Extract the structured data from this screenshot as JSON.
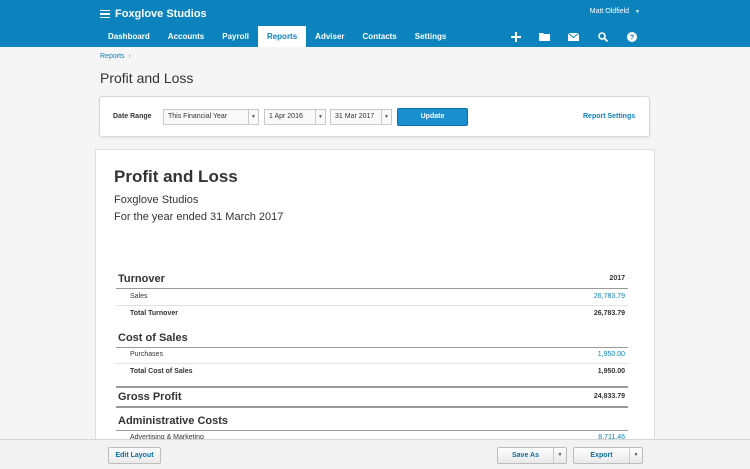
{
  "header": {
    "org_name": "Foxglove Studios",
    "user_name": "Matt Oldfield",
    "tabs": [
      {
        "label": "Dashboard"
      },
      {
        "label": "Accounts"
      },
      {
        "label": "Payroll"
      },
      {
        "label": "Reports"
      },
      {
        "label": "Adviser"
      },
      {
        "label": "Contacts"
      },
      {
        "label": "Settings"
      }
    ],
    "active_tab": "Reports",
    "icons": [
      "add-icon",
      "folder-icon",
      "mail-icon",
      "search-icon",
      "help-icon"
    ]
  },
  "breadcrumb": {
    "item": "Reports",
    "separator": "›"
  },
  "page_title": "Profit and Loss",
  "filters": {
    "date_range_label": "Date Range",
    "range_select": "This Financial Year",
    "from_date": "1 Apr 2016",
    "to_date": "31 Mar 2017",
    "update_label": "Update",
    "report_settings_label": "Report Settings"
  },
  "report": {
    "title": "Profit and Loss",
    "organisation": "Foxglove Studios",
    "period": "For the year ended 31 March 2017",
    "column_year": "2017",
    "turnover": {
      "heading": "Turnover",
      "items": [
        {
          "label": "Sales",
          "value": "26,783.79"
        }
      ],
      "total_label": "Total Turnover",
      "total_value": "26,783.79"
    },
    "cost_of_sales": {
      "heading": "Cost of Sales",
      "items": [
        {
          "label": "Purchases",
          "value": "1,950.00"
        }
      ],
      "total_label": "Total Cost of Sales",
      "total_value": "1,950.00"
    },
    "gross_profit": {
      "label": "Gross Profit",
      "value": "24,833.79"
    },
    "admin_costs": {
      "heading": "Administrative Costs",
      "items": [
        {
          "label": "Advertising & Marketing",
          "value": "8,711.46"
        }
      ]
    }
  },
  "footer": {
    "edit_layout_label": "Edit Layout",
    "save_as_label": "Save As",
    "export_label": "Export"
  },
  "colors": {
    "brand_blue": "#0d83bd",
    "link_blue": "#0d83bd",
    "update_button": "#1a8fd0"
  }
}
